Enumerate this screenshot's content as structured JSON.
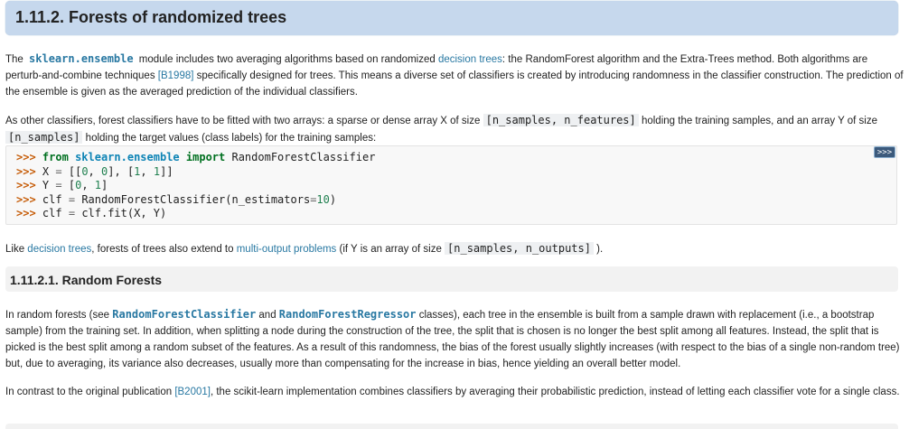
{
  "section": {
    "title": "1.11.2. Forests of randomized trees"
  },
  "para1": {
    "t1": "The ",
    "module": "sklearn.ensemble",
    "t2": " module includes two averaging algorithms based on randomized ",
    "link_decision_trees": "decision trees",
    "t3": ": the RandomForest algorithm and the Extra-Trees method. Both algorithms are perturb-and-combine techniques ",
    "ref_b1998": "[B1998]",
    "t4": " specifically designed for trees. This means a diverse set of classifiers is created by introducing randomness in the classifier construction. The prediction of the ensemble is given as the averaged prediction of the individual classifiers."
  },
  "para2": {
    "t1": "As other classifiers, forest classifiers have to be fitted with two arrays: a sparse or dense array X of size ",
    "code1": "[n_samples, n_features]",
    "t2": " holding the training samples, and an array Y of size ",
    "code2": "[n_samples]",
    "t3": " holding the target values (class labels) for the training samples:"
  },
  "code_example": {
    "copy_label": ">>>",
    "prompt": ">>>",
    "l1_from": "from",
    "l1_module": "sklearn.ensemble",
    "l1_import": "import",
    "l1_name": "RandomForestClassifier",
    "l2_lhs": "X",
    "l2_eq": "=",
    "l2_open": "[[",
    "l2_n1": "0",
    "l2_c1": ",",
    "l2_n2": "0",
    "l2_mid": "],",
    "l2_open2": "[",
    "l2_n3": "1",
    "l2_c2": ",",
    "l2_n4": "1",
    "l2_close": "]]",
    "l3_lhs": "Y",
    "l3_eq": "=",
    "l3_open": "[",
    "l3_n1": "0",
    "l3_c": ",",
    "l3_n2": "1",
    "l3_close": "]",
    "l4_lhs": "clf",
    "l4_eq": "=",
    "l4_call": "RandomForestClassifier(n_estimators",
    "l4_eq2": "=",
    "l4_num": "10",
    "l4_close": ")",
    "l5_lhs": "clf",
    "l5_eq": "=",
    "l5_rhs": "clf.fit(X, Y)"
  },
  "para3": {
    "t1": "Like ",
    "link_decision_trees": "decision trees",
    "t2": ", forests of trees also extend to ",
    "link_multi_output": "multi-output problems",
    "t3": " (if Y is an array of size ",
    "code1": "[n_samples, n_outputs]",
    "t4": " )."
  },
  "subsection": {
    "title": "1.11.2.1. Random Forests"
  },
  "para4": {
    "t1": "In random forests (see ",
    "cls1": "RandomForestClassifier",
    "t2": " and ",
    "cls2": "RandomForestRegressor",
    "t3": " classes), each tree in the ensemble is built from a sample drawn with replacement (i.e., a bootstrap sample) from the training set. In addition, when splitting a node during the construction of the tree, the split that is chosen is no longer the best split among all features. Instead, the split that is picked is the best split among a random subset of the features. As a result of this randomness, the bias of the forest usually slightly increases (with respect to the bias of a single non-random tree) but, due to averaging, its variance also decreases, usually more than compensating for the increase in bias, hence yielding an overall better model."
  },
  "para5": {
    "t1": "In contrast to the original publication ",
    "ref_b2001": "[B2001]",
    "t2": ", the scikit-learn implementation combines classifiers by averaging their probabilistic prediction, instead of letting each classifier vote for a single class."
  }
}
